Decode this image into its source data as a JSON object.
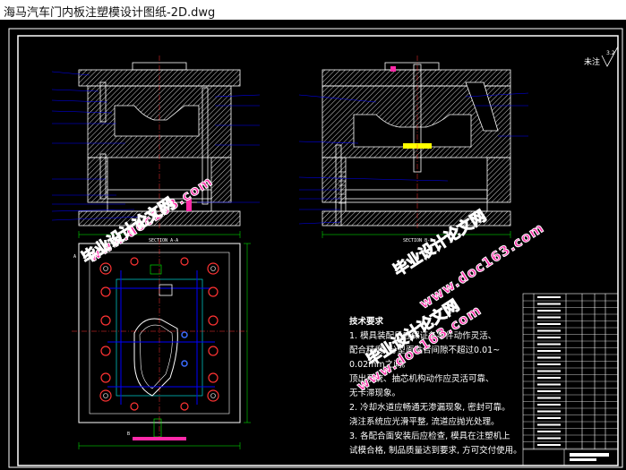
{
  "window": {
    "title": "海马汽车门内板注塑模设计图纸-2D.dwg"
  },
  "drawing": {
    "surface_finish_label": "未注",
    "roughness_value": "3.2",
    "front_view_scale_label": "SECTION A-A",
    "side_view_scale_label": "SECTION B-B",
    "bottom_view_label": "A",
    "plan_section_label": "B"
  },
  "technical_requirements": {
    "heading": "技术要求",
    "lines": [
      "1. 模具装配后应保证各零件动作灵活、",
      "配合精度, 分型面贴合间隙不超过0.01~",
      "0.02mm之间。",
      "顶出系统、抽芯机构动作应灵活可靠、",
      "无卡滞现象。",
      "2. 冷却水道应畅通无渗漏现象, 密封可靠。",
      "浇注系统应光滑平整, 流道应抛光处理。",
      "3. 各配合面安装后应检查, 模具在注塑机上",
      "试模合格, 制品质量达到要求, 方可交付使用。"
    ]
  },
  "watermarks": {
    "cn_text": "毕业设计论文网",
    "url_text": "www.doc163.com"
  },
  "colors": {
    "canvas": "#000000",
    "outline": "#ffffff",
    "leader": "#0000ff",
    "dimension": "#00ff00",
    "hatch": "#d8d8d8",
    "accent_red": "#ff3333",
    "accent_yellow": "#ffff00",
    "accent_cyan": "#00ffff",
    "watermark": "#ff2aa8"
  }
}
